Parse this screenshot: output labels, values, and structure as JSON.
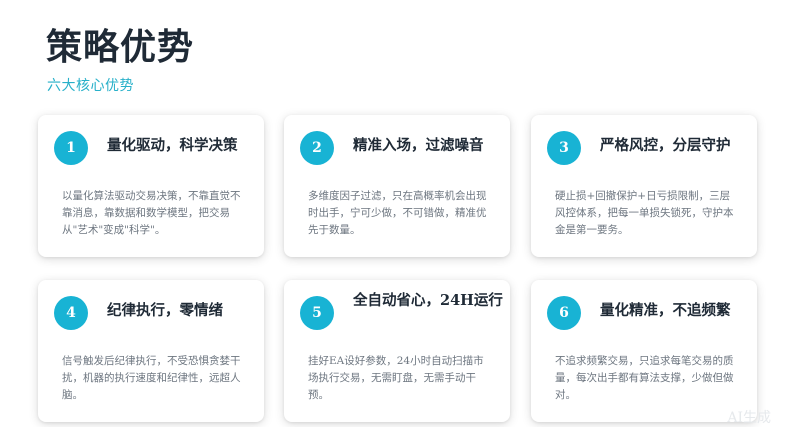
{
  "header": {
    "title": "策略优势",
    "subtitle": "六大核心优势"
  },
  "cards": [
    {
      "number": "1",
      "title": "量化驱动，科学决策",
      "description": "以量化算法驱动交易决策，不靠直觉不靠消息，靠数据和数学模型，把交易从\"艺术\"变成\"科学\"。"
    },
    {
      "number": "2",
      "title": "精准入场，过滤噪音",
      "description": "多维度因子过滤，只在高概率机会出现时出手，宁可少做，不可错做，精准优先于数量。"
    },
    {
      "number": "3",
      "title": "严格风控，分层守护",
      "description": "硬止损+回撤保护+日亏损限制，三层风控体系，把每一单损失锁死，守护本金是第一要务。"
    },
    {
      "number": "4",
      "title": "纪律执行，零情绪",
      "description": "信号触发后纪律执行，不受恐惧贪婪干扰，机器的执行速度和纪律性，远超人脑。"
    },
    {
      "number": "5",
      "title": "全自动省心，24H运行",
      "description": "挂好EA设好参数，24小时自动扫描市场执行交易，无需盯盘，无需手动干预。"
    },
    {
      "number": "6",
      "title": "量化精准，不追频繁",
      "description": "不追求频繁交易，只追求每笔交易的质量，每次出手都有算法支撑，少做但做对。"
    }
  ],
  "watermark": "AI生成"
}
